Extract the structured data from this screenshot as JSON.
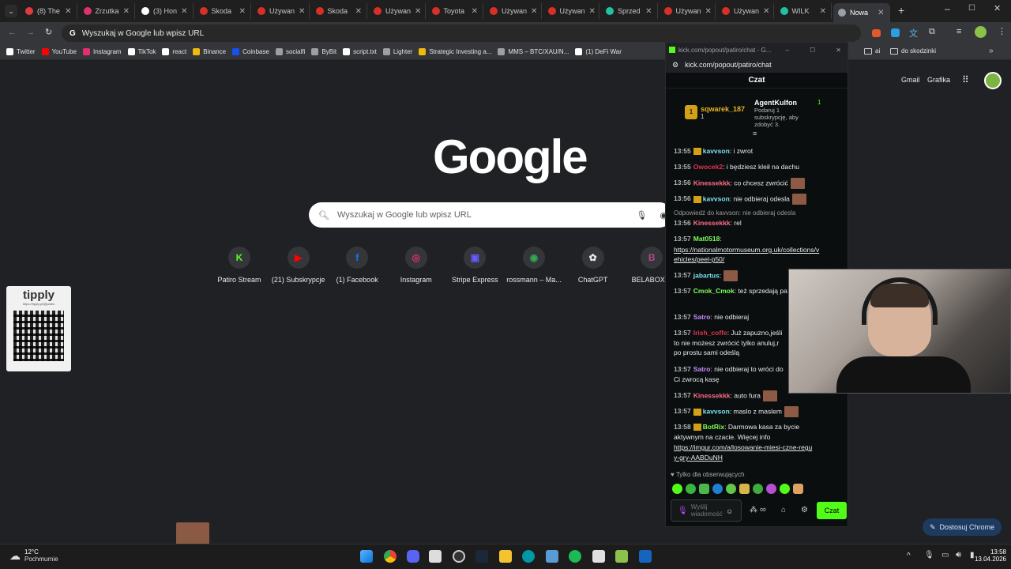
{
  "tabs": [
    {
      "label": "(8) The",
      "color": "#e03a3e"
    },
    {
      "label": "Zrzutka",
      "color": "#e0306e"
    },
    {
      "label": "(3) Hon",
      "color": "#ffffff"
    },
    {
      "label": "Skoda",
      "color": "#d93025"
    },
    {
      "label": "Używan",
      "color": "#d93025"
    },
    {
      "label": "Skoda",
      "color": "#d93025"
    },
    {
      "label": "Używan",
      "color": "#d93025"
    },
    {
      "label": "Toyota",
      "color": "#d93025"
    },
    {
      "label": "Używan",
      "color": "#d93025"
    },
    {
      "label": "Używan",
      "color": "#d93025"
    },
    {
      "label": "Sprzed",
      "color": "#23c1a3"
    },
    {
      "label": "Używan",
      "color": "#d93025"
    },
    {
      "label": "Używan",
      "color": "#d93025"
    },
    {
      "label": "WILK",
      "color": "#23c1a3"
    },
    {
      "label": "Nowa",
      "color": "#9aa0a6"
    }
  ],
  "omnibox": {
    "text": "Wyszukaj w Google lub wpisz URL"
  },
  "bookmarks": [
    {
      "label": "Twitter",
      "color": "#ffffff"
    },
    {
      "label": "YouTube",
      "color": "#ff0000"
    },
    {
      "label": "Instagram",
      "color": "#e1306c"
    },
    {
      "label": "TikTok",
      "color": "#ffffff"
    },
    {
      "label": "react",
      "color": "#ffffff"
    },
    {
      "label": "Binance",
      "color": "#f0b90b"
    },
    {
      "label": "Coinbase",
      "color": "#1652f0"
    },
    {
      "label": "socialfi",
      "color": "#9aa0a6"
    },
    {
      "label": "ByBit",
      "color": "#9aa0a6"
    },
    {
      "label": "script.txt",
      "color": "#ffffff"
    },
    {
      "label": "Lighter",
      "color": "#9aa0a6"
    },
    {
      "label": "Strategic Investing a...",
      "color": "#f0b90b"
    },
    {
      "label": "MMS – BTC/XAU/N...",
      "color": "#9aa0a6"
    },
    {
      "label": "(1) DeFi War",
      "color": "#ffffff"
    }
  ],
  "bookmarks_right": [
    {
      "label": "ai"
    },
    {
      "label": "do skodzinki"
    }
  ],
  "top_links": {
    "gmail": "Gmail",
    "grafika": "Grafika"
  },
  "google_logo": "Google",
  "search_placeholder": "Wyszukaj w Google lub wpisz URL",
  "shortcuts": [
    {
      "label": "Patiro Stream",
      "glyph": "K",
      "color": "#53fc18"
    },
    {
      "label": "(21) Subskrypcje",
      "glyph": "▶",
      "color": "#ff0000"
    },
    {
      "label": "(1) Facebook",
      "glyph": "f",
      "color": "#1877f2"
    },
    {
      "label": "Instagram",
      "glyph": "◎",
      "color": "#e1306c"
    },
    {
      "label": "Stripe Express",
      "glyph": "▣",
      "color": "#635bff"
    },
    {
      "label": "rossmann – Ma...",
      "glyph": "◉",
      "color": "#34a853"
    },
    {
      "label": "ChatGPT",
      "glyph": "✿",
      "color": "#e8eaed"
    },
    {
      "label": "BELABOX cl",
      "glyph": "B",
      "color": "#b1478f"
    }
  ],
  "tipply": {
    "label": "tipply",
    "url": "https://tipply.pl/@patiro"
  },
  "chat": {
    "window_title": "kick.com/popout/patiro/chat - G...",
    "url": "kick.com/popout/patiro/chat",
    "header": "Czat",
    "top_gifter": {
      "name": "sqwarek_187",
      "count": "1",
      "rank": "1"
    },
    "agent": {
      "name": "AgentKulfon",
      "count": "1",
      "line1": "Podaruj 1",
      "line2": "subskrypcję, aby",
      "line3": "zdobyć 3."
    },
    "messages": [
      {
        "time": "13:55",
        "user": "kavvson",
        "color": "#7be0f0",
        "text": ": i zwrot",
        "badge": true,
        "emote": false
      },
      {
        "time": "13:55",
        "user": "Owocek2",
        "color": "#e0344e",
        "text": ": i będziesz kleił na dachu",
        "badge": false,
        "emote": false
      },
      {
        "time": "13:56",
        "user": "Kinessekkk",
        "color": "#ff6b8a",
        "text": ": co chcesz zwrócić",
        "badge": false,
        "emote": true
      },
      {
        "time": "13:56",
        "user": "kavvson",
        "color": "#7be0f0",
        "text": ": nie odbieraj odesla",
        "badge": true,
        "emote": true
      }
    ],
    "reply_note": "Odpowiedź do kavvson: nie odbieraj odesla",
    "messages2": [
      {
        "time": "13:56",
        "user": "Kinessekkk",
        "color": "#ff6b8a",
        "text": ": rel"
      },
      {
        "time": "13:57",
        "user": "Mat0518",
        "color": "#7cfc5a",
        "text": ":"
      }
    ],
    "link1a": "https://nationalmotormuseum.org.uk/collections/v",
    "link1b": "ehicles/peel-p50/",
    "messages3": [
      {
        "time": "13:57",
        "user": "jabartus",
        "color": "#7be0f0",
        "text": ":"
      },
      {
        "time": "13:57",
        "user": "Cmok_Cmok",
        "color": "#7cfc5a",
        "text": ": też sprzedają pa"
      },
      {
        "time": "13:57",
        "user": "Satro",
        "color": "#c08cff",
        "text": ": nie odbieraj"
      },
      {
        "time": "13:57",
        "user": "Irish_coffe",
        "color": "#e0344e",
        "text": ": Już zapuzno,jeśli"
      }
    ],
    "irish_cont1": "to nie możesz zwrócić tylko anuluj,r",
    "irish_cont2": "po prostu sami odeślą",
    "satro2": {
      "time": "13:57",
      "user": "Satro",
      "color": "#c08cff",
      "text": ": nie odbieraj to wróci do"
    },
    "satro2_cont": "Ci zwrocą kasę",
    "messages4": [
      {
        "time": "13:57",
        "user": "Kinessekkk",
        "color": "#ff6b8a",
        "text": ": auto fura"
      },
      {
        "time": "13:57",
        "user": "kavvson",
        "color": "#7be0f0",
        "text": ": maslo z maslem"
      }
    ],
    "botrix": {
      "time": "13:58",
      "user": "BotRix",
      "color": "#7cfc5a",
      "text": ": Darmowa kasa za bycie",
      "cont": "aktywnym na czacie. Więcej info"
    },
    "link2a": "https://imgur.com/a/losowanie-miesi-czne-regu",
    "link2b": "y-gry-AABDuNH",
    "followers_only": "Tylko dla obserwujących",
    "input_placeholder": "Wyślij wiadomość",
    "send_label": "Czat"
  },
  "customize_button": "Dostosuj Chrome",
  "weather": {
    "temp": "12°C",
    "desc": "Pochmurnie"
  },
  "clock": {
    "time": "13:58",
    "date": "13.04.2026"
  }
}
